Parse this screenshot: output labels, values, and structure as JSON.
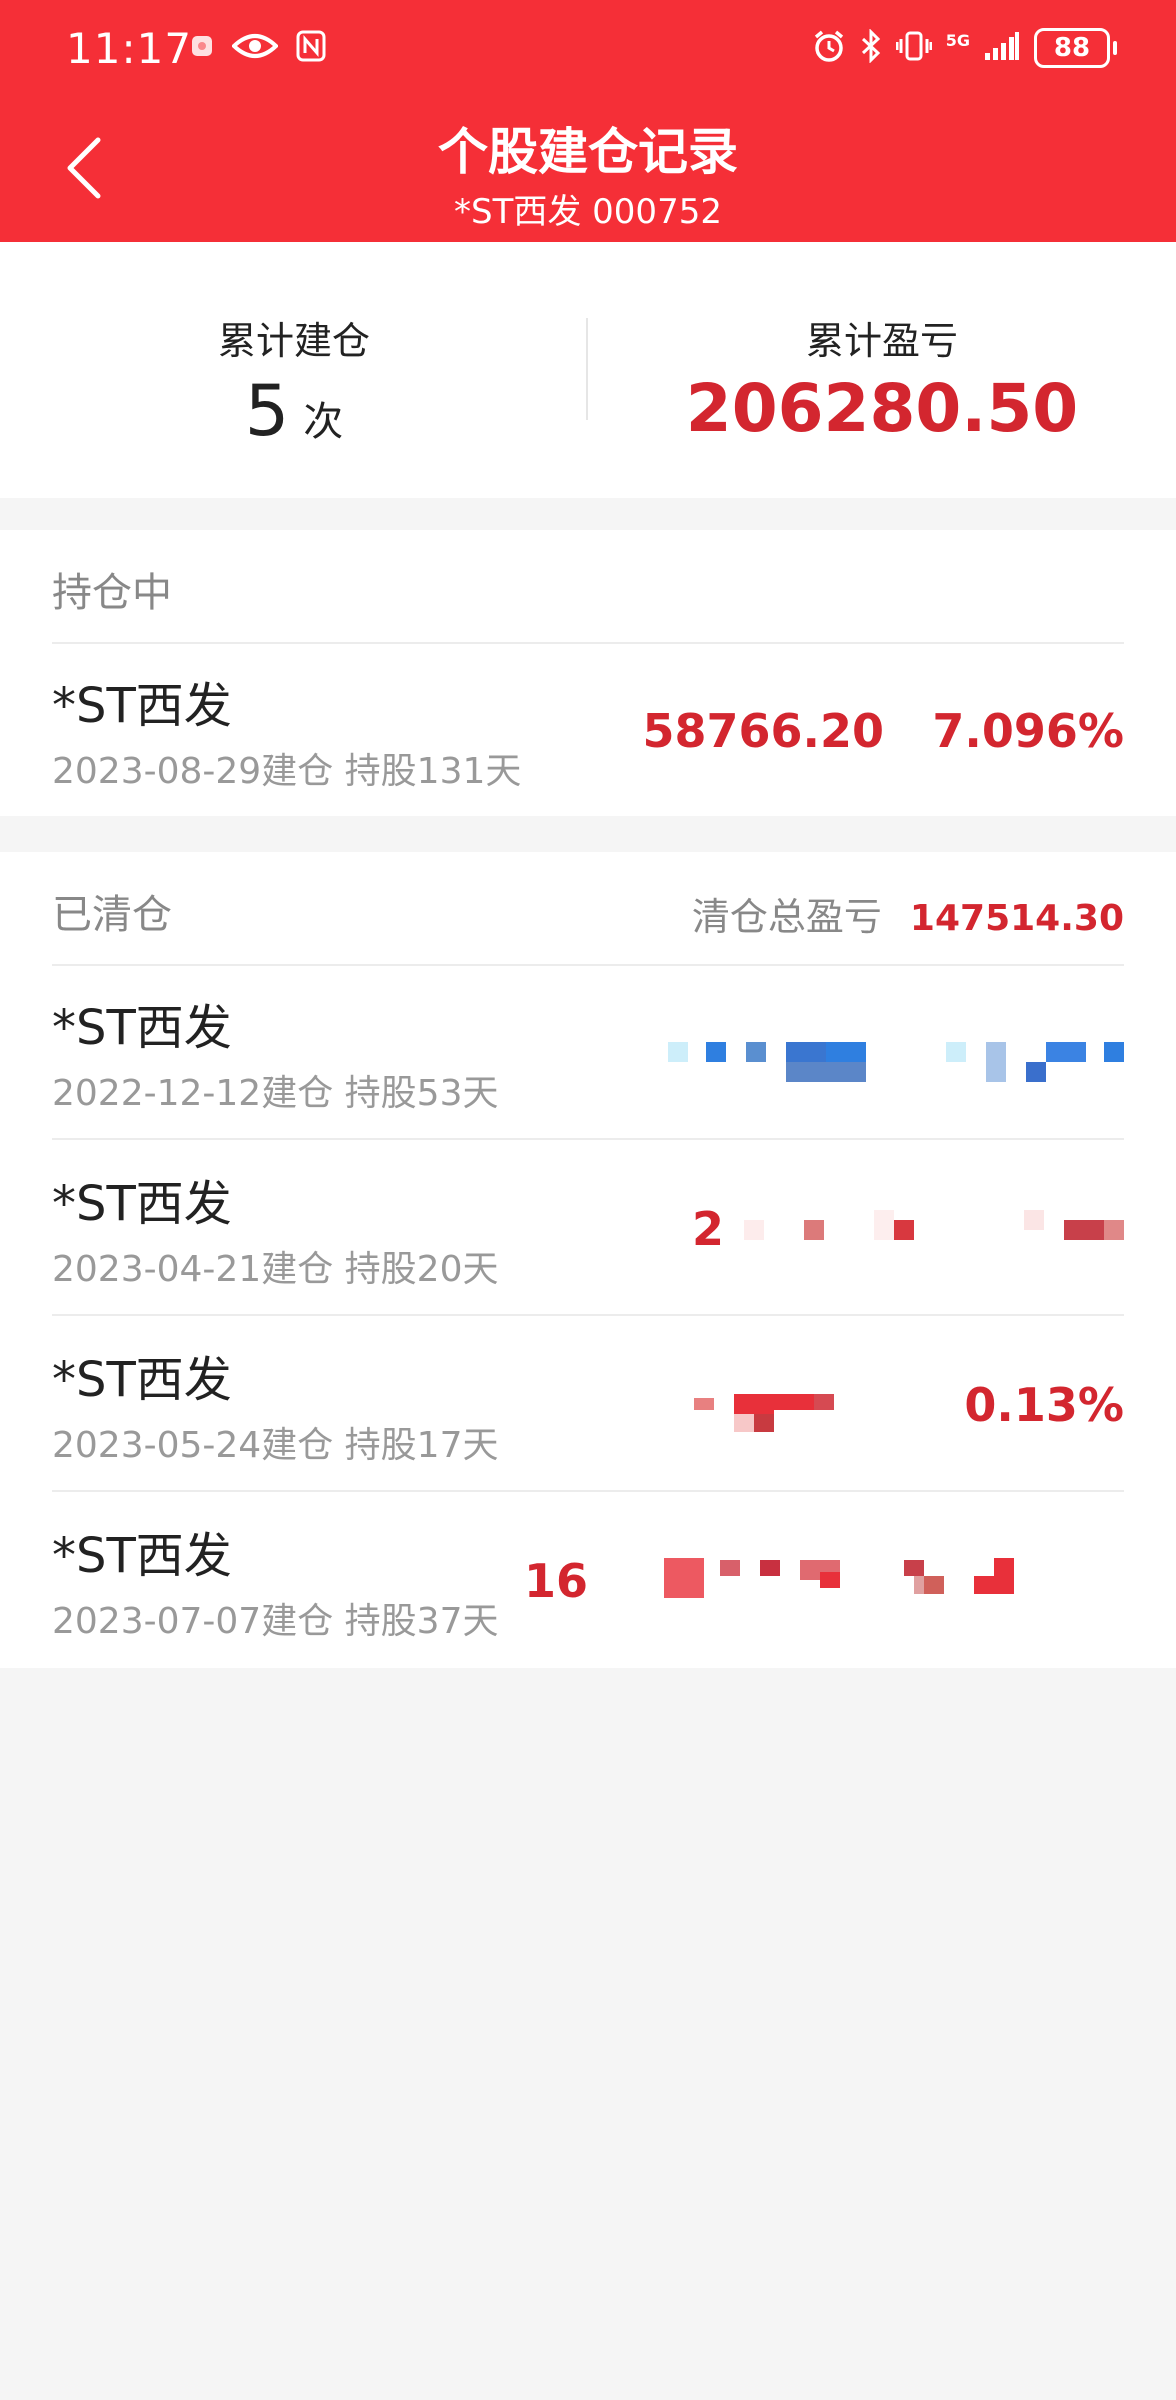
{
  "status_bar": {
    "time": "11:17",
    "battery": "88",
    "network": "5G"
  },
  "header": {
    "title": "个股建仓记录",
    "subtitle": "*ST西发 000752"
  },
  "summary": {
    "count_label": "累计建仓",
    "count_value": "5",
    "count_unit": "次",
    "pnl_label": "累计盈亏",
    "pnl_value": "206280.50"
  },
  "holding": {
    "title": "持仓中",
    "rows": [
      {
        "name": "*ST西发",
        "date": "2023-08-29建仓 持股131天",
        "amount": "58766.20",
        "pct": "7.096%"
      }
    ]
  },
  "cleared": {
    "title": "已清仓",
    "total_label": "清仓总盈亏",
    "total_value": "147514.30",
    "rows": [
      {
        "name": "*ST西发",
        "date": "2022-12-12建仓 持股53天",
        "amount": "",
        "pct": ""
      },
      {
        "name": "*ST西发",
        "date": "2023-04-21建仓 持股20天",
        "amount": "2",
        "pct": ""
      },
      {
        "name": "*ST西发",
        "date": "2023-05-24建仓 持股17天",
        "amount": "",
        "pct": "0.13%"
      },
      {
        "name": "*ST西发",
        "date": "2023-07-07建仓 持股37天",
        "amount": "16",
        "pct": ""
      }
    ]
  },
  "colors": {
    "brand_red": "#f52f37",
    "value_red": "#d3262f",
    "page_bg": "#f5f5f5"
  },
  "icons": {
    "back": "chevron-left-icon"
  }
}
